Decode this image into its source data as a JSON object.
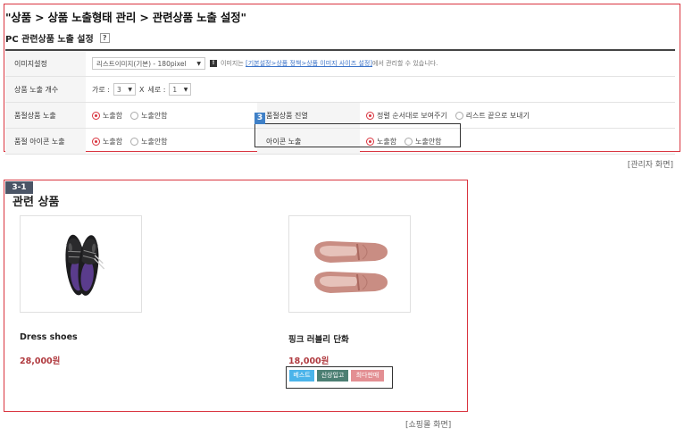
{
  "admin": {
    "title": "\"상품 > 상품 노출형태 관리 > 관련상품 노출 설정\"",
    "subtitle": "PC 관련상품 노출 설정",
    "help": "?",
    "rows": {
      "image": {
        "label": "이미지설정",
        "select_value": "리스트이미지(기본) - 180pixel",
        "note_prefix": "이미지는",
        "note_link": "[기본설정>상품 정책>상품 이미지 사이즈 설정]",
        "note_suffix": "에서 관리할 수 있습니다."
      },
      "count": {
        "label": "상품 노출 개수",
        "horizontal_label": "가로 :",
        "horizontal_value": "3",
        "times": "X",
        "vertical_label": "세로 :",
        "vertical_value": "1"
      },
      "soldout": {
        "label": "품절상품 노출",
        "on": "노출함",
        "off": "노출안함",
        "display_label": "품절상품 진열",
        "display_option1": "정렬 순서대로 보여주기",
        "display_option2": "리스트 끝으로 보내기"
      },
      "soldout_icon": {
        "label": "품절 아이콘 노출",
        "on": "노출함",
        "off": "노출안함",
        "icon_label": "아이콘 노출",
        "icon_on": "노출함",
        "icon_off": "노출안함"
      }
    },
    "marker": "3",
    "caption": "[관리자 화면]"
  },
  "shop": {
    "marker": "3-1",
    "title": "관련 상품",
    "products": [
      {
        "name": "Dress shoes",
        "price": "28,000원"
      },
      {
        "name": "핑크 러블리 단화",
        "price": "18,000원"
      }
    ],
    "tags": {
      "best": "베스트",
      "new": "신상입고",
      "sale": "최다판매"
    },
    "caption": "[쇼핑몰 화면]"
  },
  "colors": {
    "frame": "#d9343f",
    "badge_blue": "#3f80c7",
    "price": "#b03a3f",
    "tag_best": "#4bb4ea",
    "tag_new": "#4c7f73",
    "tag_sale": "#e38f93"
  }
}
